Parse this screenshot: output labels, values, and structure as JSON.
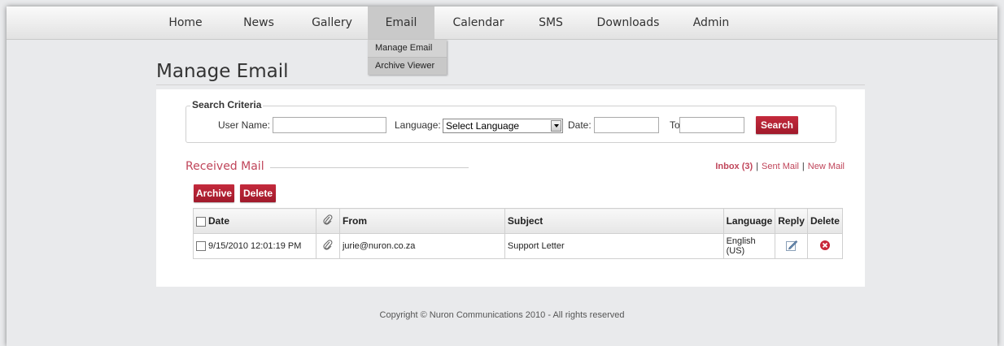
{
  "nav": {
    "items": [
      {
        "label": "Home"
      },
      {
        "label": "News"
      },
      {
        "label": "Gallery"
      },
      {
        "label": "Email",
        "active": true
      },
      {
        "label": "Calendar"
      },
      {
        "label": "SMS"
      },
      {
        "label": "Downloads"
      },
      {
        "label": "Admin"
      }
    ],
    "dropdown": [
      "Manage Email",
      "Archive Viewer"
    ]
  },
  "page_title": "Manage Email",
  "search": {
    "legend": "Search Criteria",
    "user_name_label": "User Name:",
    "user_name_value": "",
    "language_label": "Language:",
    "language_selected": "Select Language",
    "date_label": "Date:",
    "date_from_value": "",
    "to_label": "To",
    "date_to_value": "",
    "search_button": "Search"
  },
  "received": {
    "title": "Received Mail",
    "links": {
      "inbox": "Inbox (3)",
      "sent": "Sent Mail",
      "new": "New Mail"
    },
    "archive_button": "Archive",
    "delete_button": "Delete"
  },
  "table": {
    "headers": {
      "date": "Date",
      "from": "From",
      "subject": "Subject",
      "language": "Language",
      "reply": "Reply",
      "delete": "Delete"
    },
    "rows": [
      {
        "date": "9/15/2010 12:01:19 PM",
        "from": "jurie@nuron.co.za",
        "subject": "Support Letter",
        "language": "English (US)"
      }
    ]
  },
  "footer": "Copyright © Nuron Communications 2010 - All rights reserved",
  "colors": {
    "accent": "#b3243a",
    "link": "#c0455a"
  }
}
